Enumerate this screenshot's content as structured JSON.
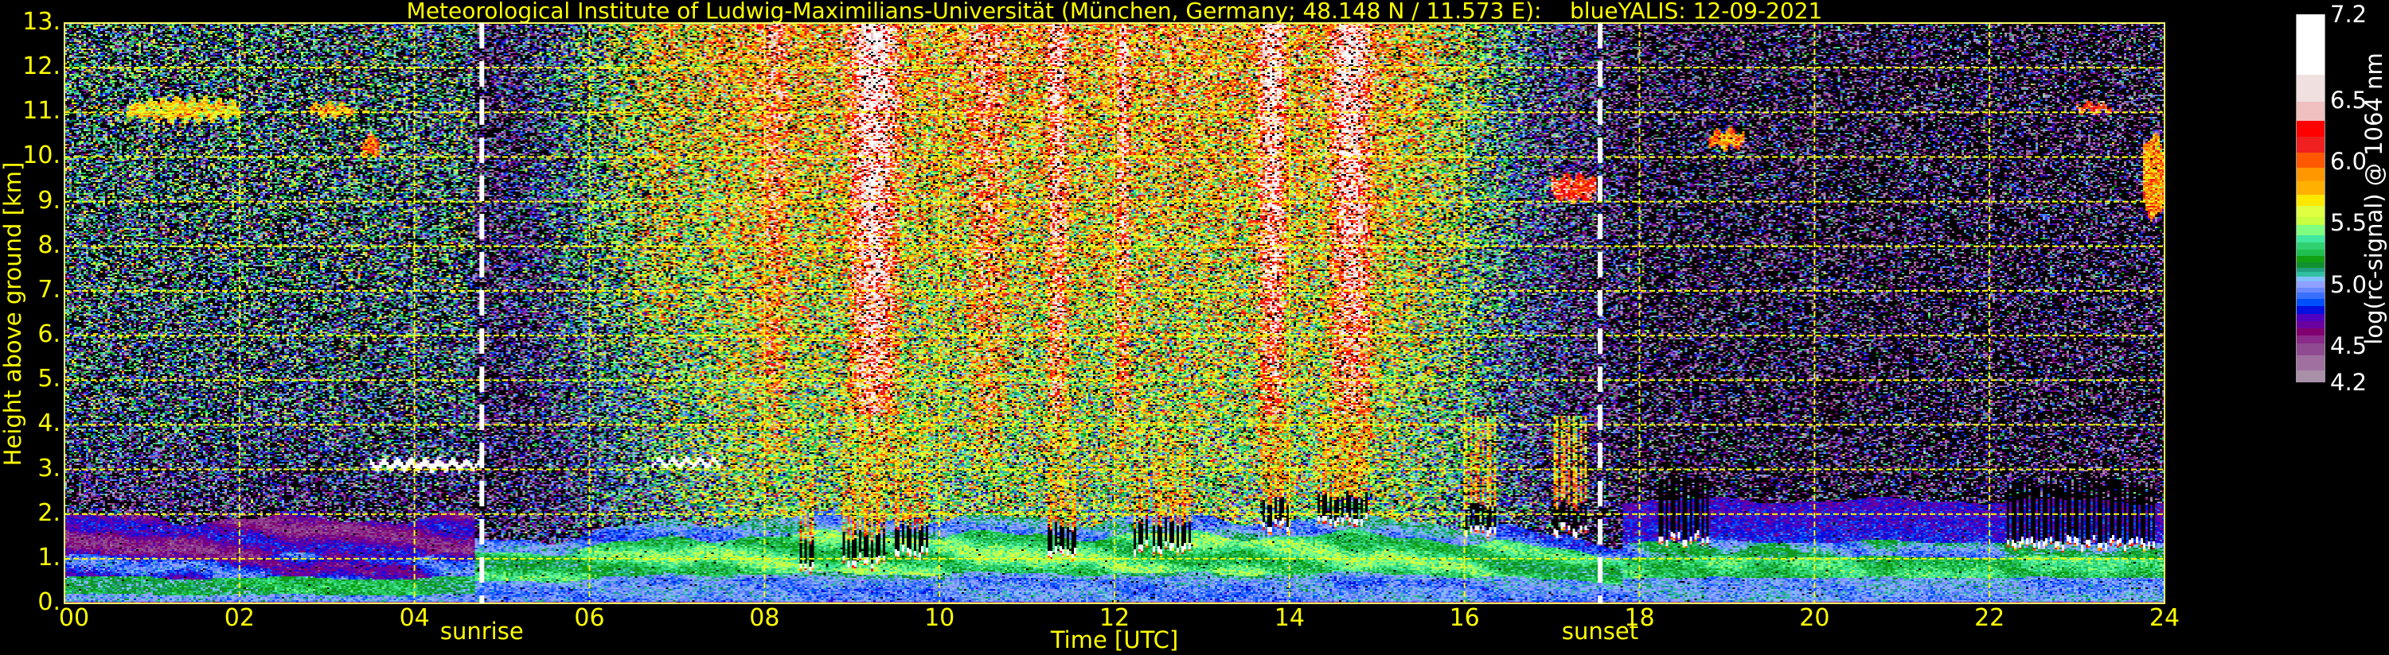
{
  "chart_data": {
    "type": "heatmap",
    "title": "Meteorological Institute of Ludwig-Maximilians-Universität (München, Germany; 48.148 N / 11.573 E):    blueYALIS: 12-09-2021",
    "xlabel": "Time [UTC]",
    "ylabel": "Height above ground [km]",
    "xlim": [
      0,
      24
    ],
    "ylim": [
      0,
      13
    ],
    "grid": true,
    "x_ticks": [
      0,
      2,
      4,
      6,
      8,
      10,
      12,
      14,
      16,
      18,
      20,
      22,
      24
    ],
    "x_tick_labels": [
      "00",
      "02",
      "04",
      "06",
      "08",
      "10",
      "12",
      "14",
      "16",
      "18",
      "20",
      "22",
      "24"
    ],
    "y_ticks": [
      0,
      1,
      2,
      3,
      4,
      5,
      6,
      7,
      8,
      9,
      10,
      11,
      12,
      13
    ],
    "y_tick_labels": [
      "0.",
      "1.",
      "2.",
      "3.",
      "4.",
      "5.",
      "6.",
      "7.",
      "8.",
      "9.",
      "10.",
      "11.",
      "12.",
      "13."
    ],
    "annotations": [
      {
        "label": "sunrise",
        "time": 4.77
      },
      {
        "label": "sunset",
        "time": 17.55
      }
    ],
    "colorbar": {
      "label": "log(rc-signal) @ 1064 nm",
      "range": [
        4.2,
        7.2
      ],
      "ticks": [
        4.2,
        4.5,
        5.0,
        5.5,
        6.0,
        6.5,
        7.2
      ],
      "tick_labels": [
        "4.2",
        "4.5",
        "5.0",
        "5.5",
        "6.0",
        "6.5",
        "7.2"
      ],
      "bins": [
        {
          "from": 4.2,
          "color": "#a890a8"
        },
        {
          "from": 4.3,
          "color": "#a070a0"
        },
        {
          "from": 4.42,
          "color": "#904a90"
        },
        {
          "from": 4.52,
          "color": "#8a2a8a"
        },
        {
          "from": 4.58,
          "color": "#800070"
        },
        {
          "from": 4.64,
          "color": "#6a00a0"
        },
        {
          "from": 4.7,
          "color": "#5000c0"
        },
        {
          "from": 4.76,
          "color": "#0010e0"
        },
        {
          "from": 4.82,
          "color": "#0050ff"
        },
        {
          "from": 4.88,
          "color": "#3a70ff"
        },
        {
          "from": 4.93,
          "color": "#6a88ff"
        },
        {
          "from": 4.97,
          "color": "#90a0ff"
        },
        {
          "from": 5.02,
          "color": "#80c0ff"
        },
        {
          "from": 5.06,
          "color": "#30c0a0"
        },
        {
          "from": 5.1,
          "color": "#20a080"
        },
        {
          "from": 5.13,
          "color": "#109030"
        },
        {
          "from": 5.18,
          "color": "#10a010"
        },
        {
          "from": 5.23,
          "color": "#20c050"
        },
        {
          "from": 5.28,
          "color": "#30d070"
        },
        {
          "from": 5.34,
          "color": "#40e8a0"
        },
        {
          "from": 5.4,
          "color": "#80ff80"
        },
        {
          "from": 5.48,
          "color": "#c8ff40"
        },
        {
          "from": 5.55,
          "color": "#e0ff40"
        },
        {
          "from": 5.64,
          "color": "#ffe800"
        },
        {
          "from": 5.73,
          "color": "#ffb000"
        },
        {
          "from": 5.84,
          "color": "#ff9800"
        },
        {
          "from": 5.95,
          "color": "#ff5800"
        },
        {
          "from": 6.07,
          "color": "#f02020"
        },
        {
          "from": 6.2,
          "color": "#ff0000"
        },
        {
          "from": 6.33,
          "color": "#f0c0c0"
        },
        {
          "from": 6.49,
          "color": "#f0e0e0"
        },
        {
          "from": 6.71,
          "color": "#ffffff"
        }
      ]
    },
    "features": {
      "thin_clouds": [
        {
          "t": [
            0.7,
            2.0
          ],
          "h": [
            10.8,
            11.3
          ],
          "value": 5.7
        },
        {
          "t": [
            2.8,
            3.3
          ],
          "h": [
            10.9,
            11.2
          ],
          "value": 5.8
        },
        {
          "t": [
            3.4,
            3.6
          ],
          "h": [
            10.0,
            10.5
          ],
          "value": 6.0
        },
        {
          "t": [
            3.5,
            4.75
          ],
          "h": [
            3.0,
            3.2
          ],
          "value": 7.0
        },
        {
          "t": [
            6.7,
            7.5
          ],
          "h": [
            3.08,
            3.22
          ],
          "value": 7.0
        },
        {
          "t": [
            17.0,
            17.5
          ],
          "h": [
            9.0,
            9.6
          ],
          "value": 6.2
        },
        {
          "t": [
            18.8,
            19.2
          ],
          "h": [
            10.2,
            10.6
          ],
          "value": 5.9
        },
        {
          "t": [
            23.0,
            23.4
          ],
          "h": [
            11.0,
            11.2
          ],
          "value": 6.2
        },
        {
          "t": [
            23.75,
            24.0
          ],
          "h": [
            8.6,
            10.5
          ],
          "value": 5.9
        }
      ],
      "low_clouds": [
        {
          "t": [
            8.4,
            8.6
          ],
          "base": 0.8
        },
        {
          "t": [
            8.9,
            9.4
          ],
          "base": 0.9
        },
        {
          "t": [
            9.5,
            9.9
          ],
          "base": 1.1
        },
        {
          "t": [
            11.2,
            11.6
          ],
          "base": 1.1
        },
        {
          "t": [
            12.2,
            12.9
          ],
          "base": 1.2
        },
        {
          "t": [
            13.7,
            14.0
          ],
          "base": 1.7
        },
        {
          "t": [
            14.3,
            14.9
          ],
          "base": 1.8
        },
        {
          "t": [
            16.0,
            16.4
          ],
          "base": 1.6
        },
        {
          "t": [
            17.0,
            17.4
          ],
          "base": 1.6
        },
        {
          "t": [
            18.2,
            18.8
          ],
          "base": 1.4
        },
        {
          "t": [
            22.2,
            23.9
          ],
          "base": 1.3
        }
      ],
      "bright_columns": [
        {
          "t": [
            8.9,
            9.6
          ],
          "strength": 0.9
        },
        {
          "t": [
            11.2,
            11.5
          ],
          "strength": 0.7
        },
        {
          "t": [
            12.0,
            12.2
          ],
          "strength": 0.6
        },
        {
          "t": [
            13.6,
            14.0
          ],
          "strength": 0.8
        },
        {
          "t": [
            14.4,
            15.0
          ],
          "strength": 0.8
        },
        {
          "t": [
            7.9,
            8.3
          ],
          "strength": 0.4
        },
        {
          "t": [
            10.3,
            10.8
          ],
          "strength": 0.4
        }
      ]
    }
  }
}
